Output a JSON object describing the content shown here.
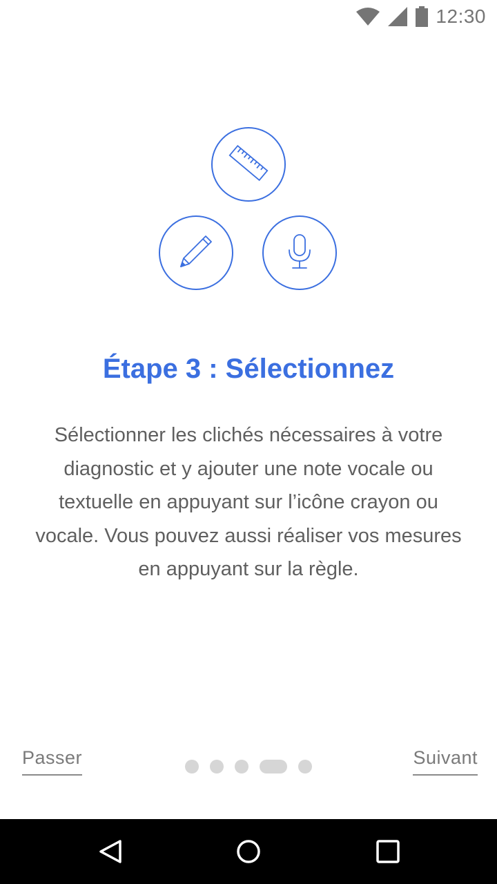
{
  "status_bar": {
    "time": "12:30",
    "icons": [
      "wifi-icon",
      "signal-icon",
      "battery-icon"
    ]
  },
  "onboarding": {
    "icons": [
      "ruler-icon",
      "pencil-icon",
      "microphone-icon"
    ],
    "title": "Étape 3 : Sélectionnez",
    "description": "Sélectionner les clichés nécessaires à votre diagnostic et y ajouter une note vocale ou textuelle en appuyant sur l’icône crayon ou vocale. Vous pouvez aussi réaliser vos mesures en appuyant sur la règle.",
    "page_indicator": {
      "total": 5,
      "current": 4
    }
  },
  "footer": {
    "skip_label": "Passer",
    "next_label": "Suivant"
  },
  "nav_bar": {
    "icons": [
      "back-icon",
      "home-icon",
      "recents-icon"
    ]
  },
  "colors": {
    "accent": "#3b6fe0",
    "text": "#5f5f5f",
    "dot_inactive": "#d6d6d6"
  }
}
